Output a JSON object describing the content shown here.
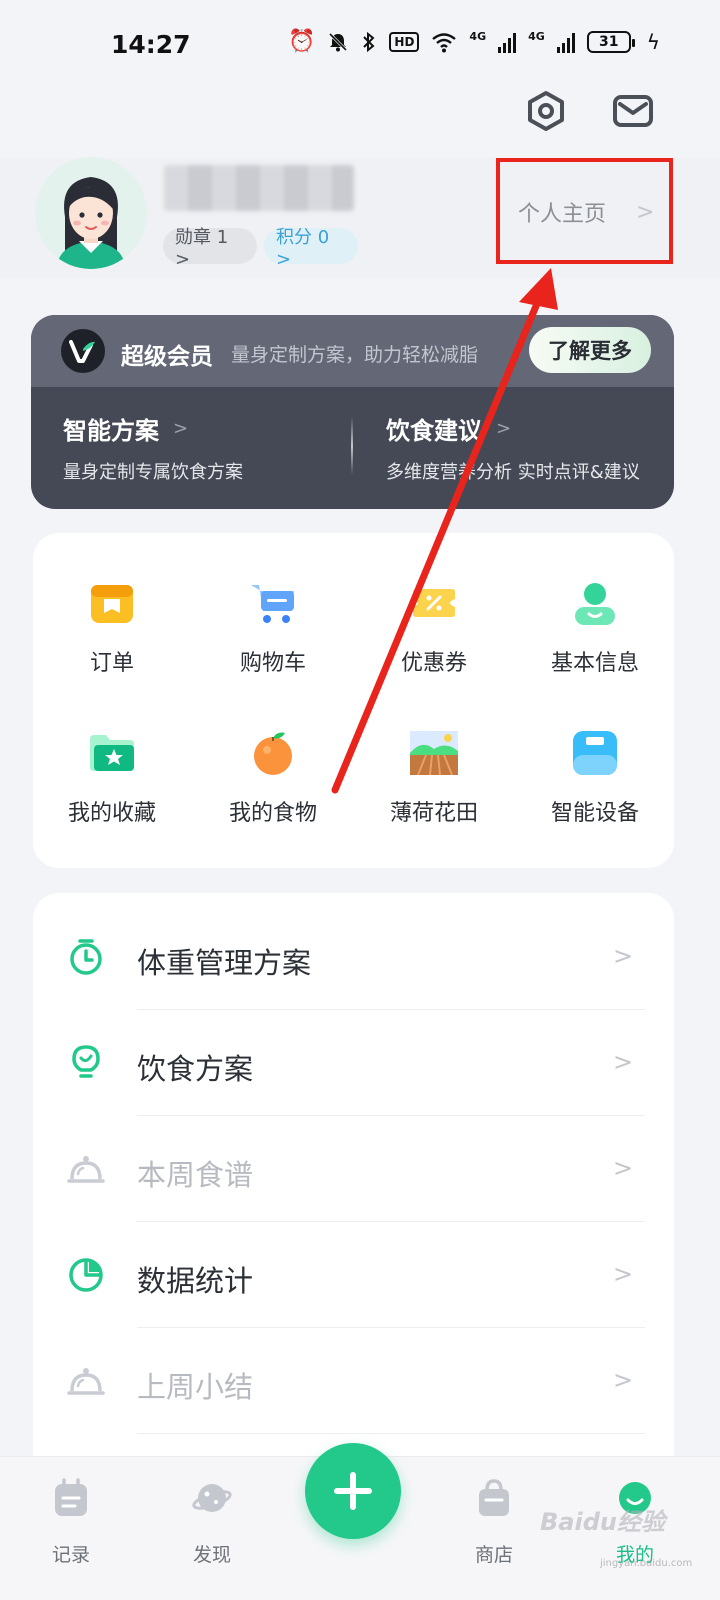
{
  "status_bar": {
    "time": "14:27",
    "hd_label": "HD",
    "network_1": "4G",
    "network_2": "4G",
    "battery": "31"
  },
  "header": {
    "settings_icon": "settings-icon",
    "mail_icon": "mail-icon"
  },
  "profile": {
    "medal_label": "勋章 1 >",
    "points_label": "积分 0 >",
    "home_label": "个人主页",
    "home_chevron": ">"
  },
  "vip": {
    "logo": "V",
    "title": "超级会员",
    "slogan": "量身定制方案，助力轻松减脂",
    "more_button": "了解更多",
    "features": [
      {
        "title": "智能方案",
        "subtitle": "量身定制专属饮食方案"
      },
      {
        "title": "饮食建议",
        "subtitle": "多维度营养分析 实时点评&建议"
      }
    ]
  },
  "grid": {
    "items": [
      {
        "label": "订单",
        "icon": "order-box-icon"
      },
      {
        "label": "购物车",
        "icon": "shopping-cart-icon"
      },
      {
        "label": "优惠券",
        "icon": "coupon-icon"
      },
      {
        "label": "基本信息",
        "icon": "user-info-icon"
      },
      {
        "label": "我的收藏",
        "icon": "favorites-folder-icon"
      },
      {
        "label": "我的食物",
        "icon": "orange-fruit-icon"
      },
      {
        "label": "薄荷花田",
        "icon": "field-landscape-icon"
      },
      {
        "label": "智能设备",
        "icon": "smart-scale-icon"
      }
    ]
  },
  "menu": {
    "items": [
      {
        "label": "体重管理方案",
        "icon": "timer-icon"
      },
      {
        "label": "饮食方案",
        "icon": "lightbulb-icon"
      },
      {
        "label": "本周食谱",
        "icon": "food-cloche-icon"
      },
      {
        "label": "数据统计",
        "icon": "pie-chart-icon"
      },
      {
        "label": "上周小结",
        "icon": "food-cloche-icon"
      }
    ],
    "chevron": ">"
  },
  "bottom_nav": {
    "items": [
      {
        "label": "记录",
        "icon": "calendar-note-icon",
        "active": false
      },
      {
        "label": "发现",
        "icon": "planet-icon",
        "active": false
      },
      {
        "label": "商店",
        "icon": "shopping-bag-icon",
        "active": false
      },
      {
        "label": "我的",
        "icon": "profile-face-icon",
        "active": true
      }
    ],
    "fab": "+"
  },
  "watermark": {
    "text": "Baidu经验",
    "sub": "jingyan.baidu.com"
  },
  "colors": {
    "accent": "#22c98b",
    "annotation": "#e8241d"
  }
}
